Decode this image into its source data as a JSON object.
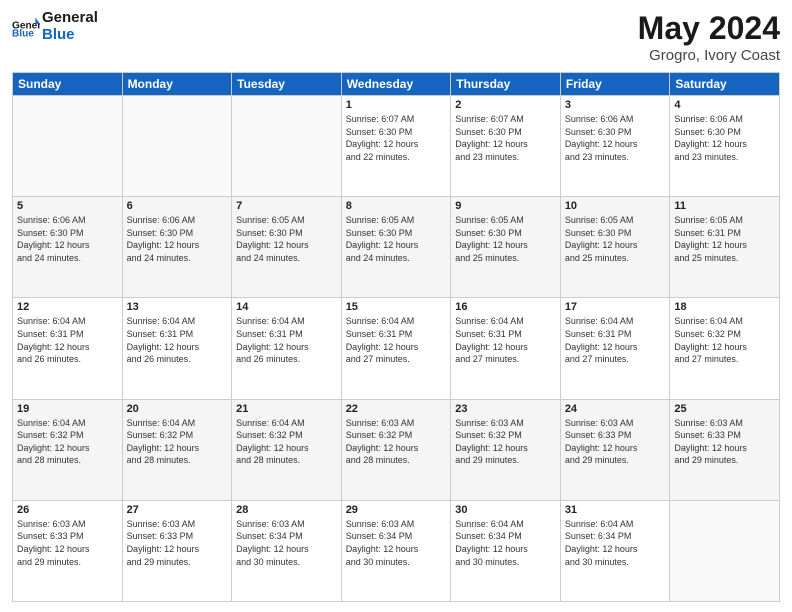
{
  "header": {
    "logo_general": "General",
    "logo_blue": "Blue",
    "title": "May 2024",
    "subtitle": "Grogro, Ivory Coast"
  },
  "weekdays": [
    "Sunday",
    "Monday",
    "Tuesday",
    "Wednesday",
    "Thursday",
    "Friday",
    "Saturday"
  ],
  "weeks": [
    [
      {
        "day": "",
        "info": ""
      },
      {
        "day": "",
        "info": ""
      },
      {
        "day": "",
        "info": ""
      },
      {
        "day": "1",
        "info": "Sunrise: 6:07 AM\nSunset: 6:30 PM\nDaylight: 12 hours\nand 22 minutes."
      },
      {
        "day": "2",
        "info": "Sunrise: 6:07 AM\nSunset: 6:30 PM\nDaylight: 12 hours\nand 23 minutes."
      },
      {
        "day": "3",
        "info": "Sunrise: 6:06 AM\nSunset: 6:30 PM\nDaylight: 12 hours\nand 23 minutes."
      },
      {
        "day": "4",
        "info": "Sunrise: 6:06 AM\nSunset: 6:30 PM\nDaylight: 12 hours\nand 23 minutes."
      }
    ],
    [
      {
        "day": "5",
        "info": "Sunrise: 6:06 AM\nSunset: 6:30 PM\nDaylight: 12 hours\nand 24 minutes."
      },
      {
        "day": "6",
        "info": "Sunrise: 6:06 AM\nSunset: 6:30 PM\nDaylight: 12 hours\nand 24 minutes."
      },
      {
        "day": "7",
        "info": "Sunrise: 6:05 AM\nSunset: 6:30 PM\nDaylight: 12 hours\nand 24 minutes."
      },
      {
        "day": "8",
        "info": "Sunrise: 6:05 AM\nSunset: 6:30 PM\nDaylight: 12 hours\nand 24 minutes."
      },
      {
        "day": "9",
        "info": "Sunrise: 6:05 AM\nSunset: 6:30 PM\nDaylight: 12 hours\nand 25 minutes."
      },
      {
        "day": "10",
        "info": "Sunrise: 6:05 AM\nSunset: 6:30 PM\nDaylight: 12 hours\nand 25 minutes."
      },
      {
        "day": "11",
        "info": "Sunrise: 6:05 AM\nSunset: 6:31 PM\nDaylight: 12 hours\nand 25 minutes."
      }
    ],
    [
      {
        "day": "12",
        "info": "Sunrise: 6:04 AM\nSunset: 6:31 PM\nDaylight: 12 hours\nand 26 minutes."
      },
      {
        "day": "13",
        "info": "Sunrise: 6:04 AM\nSunset: 6:31 PM\nDaylight: 12 hours\nand 26 minutes."
      },
      {
        "day": "14",
        "info": "Sunrise: 6:04 AM\nSunset: 6:31 PM\nDaylight: 12 hours\nand 26 minutes."
      },
      {
        "day": "15",
        "info": "Sunrise: 6:04 AM\nSunset: 6:31 PM\nDaylight: 12 hours\nand 27 minutes."
      },
      {
        "day": "16",
        "info": "Sunrise: 6:04 AM\nSunset: 6:31 PM\nDaylight: 12 hours\nand 27 minutes."
      },
      {
        "day": "17",
        "info": "Sunrise: 6:04 AM\nSunset: 6:31 PM\nDaylight: 12 hours\nand 27 minutes."
      },
      {
        "day": "18",
        "info": "Sunrise: 6:04 AM\nSunset: 6:32 PM\nDaylight: 12 hours\nand 27 minutes."
      }
    ],
    [
      {
        "day": "19",
        "info": "Sunrise: 6:04 AM\nSunset: 6:32 PM\nDaylight: 12 hours\nand 28 minutes."
      },
      {
        "day": "20",
        "info": "Sunrise: 6:04 AM\nSunset: 6:32 PM\nDaylight: 12 hours\nand 28 minutes."
      },
      {
        "day": "21",
        "info": "Sunrise: 6:04 AM\nSunset: 6:32 PM\nDaylight: 12 hours\nand 28 minutes."
      },
      {
        "day": "22",
        "info": "Sunrise: 6:03 AM\nSunset: 6:32 PM\nDaylight: 12 hours\nand 28 minutes."
      },
      {
        "day": "23",
        "info": "Sunrise: 6:03 AM\nSunset: 6:32 PM\nDaylight: 12 hours\nand 29 minutes."
      },
      {
        "day": "24",
        "info": "Sunrise: 6:03 AM\nSunset: 6:33 PM\nDaylight: 12 hours\nand 29 minutes."
      },
      {
        "day": "25",
        "info": "Sunrise: 6:03 AM\nSunset: 6:33 PM\nDaylight: 12 hours\nand 29 minutes."
      }
    ],
    [
      {
        "day": "26",
        "info": "Sunrise: 6:03 AM\nSunset: 6:33 PM\nDaylight: 12 hours\nand 29 minutes."
      },
      {
        "day": "27",
        "info": "Sunrise: 6:03 AM\nSunset: 6:33 PM\nDaylight: 12 hours\nand 29 minutes."
      },
      {
        "day": "28",
        "info": "Sunrise: 6:03 AM\nSunset: 6:34 PM\nDaylight: 12 hours\nand 30 minutes."
      },
      {
        "day": "29",
        "info": "Sunrise: 6:03 AM\nSunset: 6:34 PM\nDaylight: 12 hours\nand 30 minutes."
      },
      {
        "day": "30",
        "info": "Sunrise: 6:04 AM\nSunset: 6:34 PM\nDaylight: 12 hours\nand 30 minutes."
      },
      {
        "day": "31",
        "info": "Sunrise: 6:04 AM\nSunset: 6:34 PM\nDaylight: 12 hours\nand 30 minutes."
      },
      {
        "day": "",
        "info": ""
      }
    ]
  ]
}
